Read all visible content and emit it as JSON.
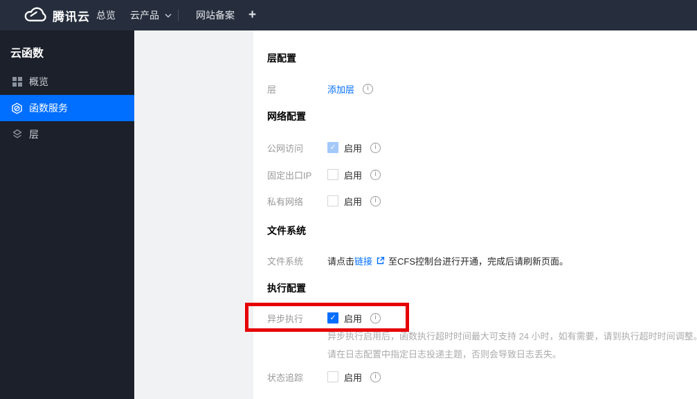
{
  "colors": {
    "accent": "#006eff",
    "annotation_red": "#e60000",
    "topnav_bg": "#262e3d",
    "sidebar_bg": "#1b202a",
    "checkbox_disabled_checked": "#a4c9f9"
  },
  "topnav": {
    "brand": "腾讯云",
    "overview": "总览",
    "cloud_products": "云产品",
    "icp_filing": "网站备案",
    "add_tab": "+"
  },
  "sidebar": {
    "title": "云函数",
    "items": [
      {
        "label": "概览",
        "icon": "grid-icon",
        "active": false
      },
      {
        "label": "函数服务",
        "icon": "function-icon",
        "active": true
      },
      {
        "label": "层",
        "icon": "layers-icon",
        "active": false
      }
    ]
  },
  "main": {
    "layer_section": {
      "heading": "层配置",
      "label": "层",
      "add_layer_link": "添加层"
    },
    "network_section": {
      "heading": "网络配置",
      "rows": [
        {
          "label": "公网访问",
          "checkbox_label": "启用",
          "checked": true,
          "disabled": true
        },
        {
          "label": "固定出口IP",
          "checkbox_label": "启用",
          "checked": false,
          "disabled": false
        },
        {
          "label": "私有网络",
          "checkbox_label": "启用",
          "checked": false,
          "disabled": false
        }
      ]
    },
    "filesystem_section": {
      "heading": "文件系统",
      "label": "文件系统",
      "text_before_link": "请点击",
      "link_text": "链接",
      "text_after_link": "至CFS控制台进行开通，完成后请刷新页面。"
    },
    "execution_section": {
      "heading": "执行配置",
      "async_row": {
        "label": "异步执行",
        "checkbox_label": "启用",
        "checked": true
      },
      "helper_line1": "异步执行启用后，函数执行超时时间最大可支持 24 小时，如有需要，请到执行超时时间调整。",
      "helper_line2": "请在日志配置中指定日志投递主题，否则会导致日志丢失。",
      "trace_row": {
        "label": "状态追踪",
        "checkbox_label": "启用",
        "checked": false
      }
    }
  }
}
